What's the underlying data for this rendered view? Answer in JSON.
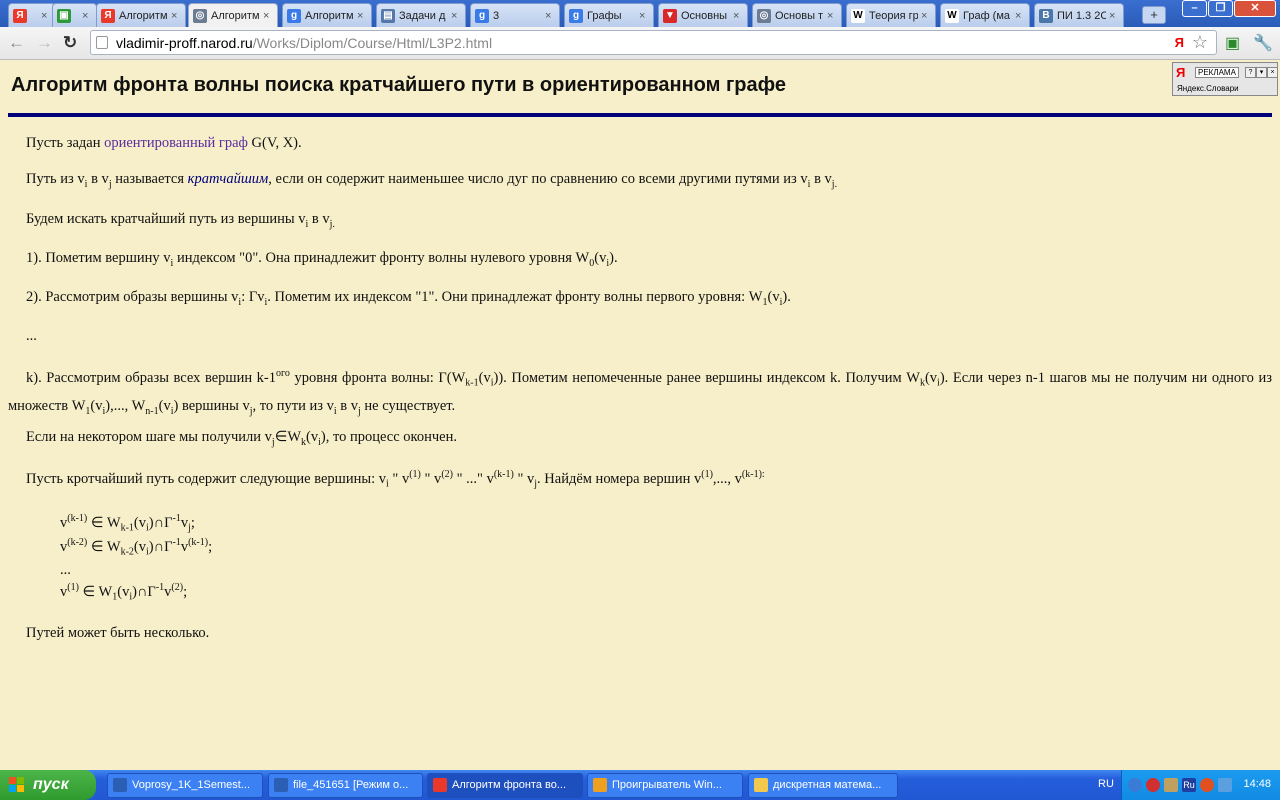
{
  "tabs": [
    {
      "title": "",
      "fav": "Я",
      "color": "#e8392a"
    },
    {
      "title": "",
      "fav": "▣",
      "color": "#2d9a3a"
    },
    {
      "title": "Алгоритм",
      "fav": "Я",
      "color": "#e8392a"
    },
    {
      "title": "Алгоритм",
      "fav": "◎",
      "color": "#6c7d93"
    },
    {
      "title": "Алгоритм",
      "fav": "g",
      "color": "#3b7be8"
    },
    {
      "title": "Задачи д",
      "fav": "▤",
      "color": "#5577aa"
    },
    {
      "title": "3",
      "fav": "g",
      "color": "#3b7be8"
    },
    {
      "title": "Графы",
      "fav": "g",
      "color": "#3b7be8"
    },
    {
      "title": "Основны",
      "fav": "▼",
      "color": "#d8282a"
    },
    {
      "title": "Основы т",
      "fav": "◎",
      "color": "#6c7d93"
    },
    {
      "title": "Теория гр",
      "fav": "W",
      "color": "#ffffff"
    },
    {
      "title": "Граф (ма",
      "fav": "W",
      "color": "#ffffff"
    },
    {
      "title": "ПИ 1.3 2С",
      "fav": "B",
      "color": "#4a76a8"
    }
  ],
  "window_buttons": {
    "minimize": "–",
    "maximize": "❐",
    "close": "✕"
  },
  "toolbar": {
    "back": "←",
    "forward": "→",
    "reload": "↻",
    "url_host": "vladimir-proff.narod.ru",
    "url_path": "/Works/Diplom/Course/Html/L3P2.html",
    "ya_badge": "Я",
    "star": "☆",
    "wrench": "🔧"
  },
  "ad": {
    "ya": "Я",
    "label": "РЕКЛАМА",
    "sub": "Яндекс.Словари"
  },
  "page": {
    "title": "Алгоритм фронта волны поиска кратчайшего пути в ориентированном графе",
    "p1_a": "Пусть задан ",
    "p1_link": "ориентированный граф",
    "p1_b": " G(V, X).",
    "p2_a": "Путь из v",
    "p2_b": " в v",
    "p2_c": " называется ",
    "p2_em": "кратчайшим",
    "p2_d": ", если он содержит наименьшее число дуг по сравнению со всеми другими путями из v",
    "p2_e": " в v",
    "p3_a": "Будем искать кратчайший путь из вершины v",
    "p3_b": " в v",
    "p4_a": "1). Пометим вершину v",
    "p4_b": " индексом \"0\". Она принадлежит фронту волны нулевого уровня W",
    "p4_c": "(v",
    "p4_d": ").",
    "p5_a": "2). Рассмотрим образы вершины v",
    "p5_b": ": Гv",
    "p5_c": ". Пометим их индексом \"1\". Они принадлежат фронту волны первого уровня: W",
    "p5_d": "(v",
    "p5_e": ").",
    "ellipsis": "...",
    "pk_a": "k). Рассмотрим образы всех вершин k-1",
    "pk_sup": "ого",
    "pk_b": " уровня фронта волны: Г(W",
    "pk_c": "(v",
    "pk_d": ")). Пометим непомеченные ранее вершины индексом k. Получим W",
    "pk_e": "(v",
    "pk_f": "). Если через n-1 шагов мы не получим ни одного из множеств W",
    "pk_g": "(v",
    "pk_h": "),..., W",
    "pk_i": "(v",
    "pk_j": ") вершины v",
    "pk_k": ", то пути из v",
    "pk_l": " в v",
    "pk_m": " не существует.",
    "p7_a": "Если на некотором шаге мы получили v",
    "p7_b": "∈W",
    "p7_c": "(v",
    "p7_d": "), то процесс окончен.",
    "p8_a": "Пусть кротчайший путь содержит следующие вершины: v",
    "p8_b": " \" v",
    "p8_c": " \" v",
    "p8_d": " \" ...\" v",
    "p8_e": " \" v",
    "p8_f": ". Найдём номера вершин v",
    "p8_g": ",..., v",
    "p8_h": ":",
    "f1_a": "v",
    "f1_b": " ∈ W",
    "f1_c": "(v",
    "f1_d": ")∩Г",
    "f1_e": "v",
    "f1_f": ";",
    "f2_a": "v",
    "f2_b": " ∈ W",
    "f2_c": "(v",
    "f2_d": ")∩Г",
    "f2_e": "v",
    "f2_f": ";",
    "f3": "...",
    "f4_a": "v",
    "f4_b": " ∈ W",
    "f4_c": "(v",
    "f4_d": ")∩Г",
    "f4_e": "v",
    "f4_f": ";",
    "last": "Путей может быть несколько.",
    "sub_i": "i",
    "sub_j": "j",
    "sub_j_dot": "j.",
    "sub_j_colon": "j:",
    "sub_0": "0",
    "sub_1": "1",
    "sub_k": "k",
    "sub_k1": "k-1",
    "sub_k2": "k-2",
    "sub_n1": "n-1",
    "sup_1": "(1)",
    "sup_2": "(2)",
    "sup_k1": "(k-1)",
    "sup_k1c": "(k-1):",
    "sup_k2": "(k-2)",
    "sup_m1": "-1",
    "sub_j_semi": "j"
  },
  "taskbar": {
    "start": "пуск",
    "tasks": [
      {
        "label": "Voprosy_1K_1Semest...",
        "color": "#2b5fb4"
      },
      {
        "label": "file_451651 [Режим о...",
        "color": "#2b5fb4"
      },
      {
        "label": "Алгоритм фронта во...",
        "color": "#e8392a"
      },
      {
        "label": "Проигрыватель Win...",
        "color": "#f0a020"
      },
      {
        "label": "дискретная матема...",
        "color": "#f2c94c"
      }
    ],
    "lang": "RU",
    "clock": "14:48"
  }
}
